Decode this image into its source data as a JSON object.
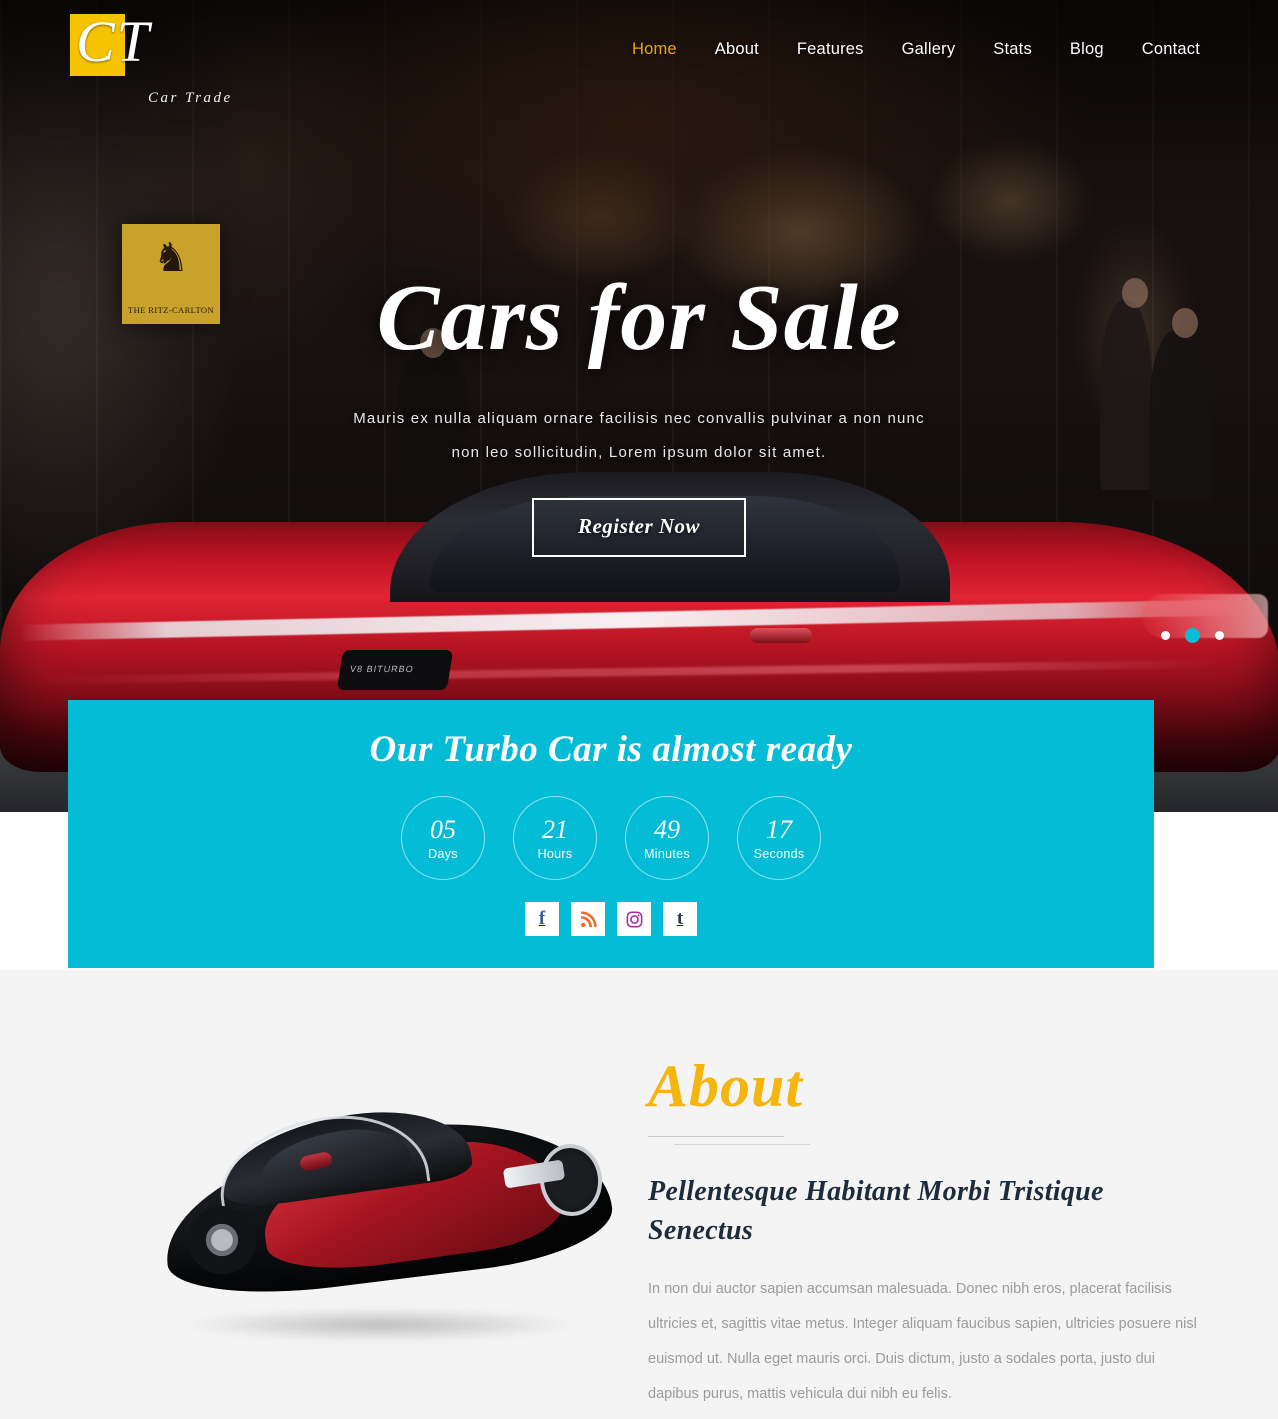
{
  "brand": {
    "logo_letters": "CT",
    "logo_tagline": "Car Trade",
    "accent_gold": "#f5c300",
    "accent_cyan": "#05bcd6",
    "accent_amber": "#f5b50f"
  },
  "nav": {
    "items": [
      {
        "label": "Home",
        "active": true
      },
      {
        "label": "About",
        "active": false
      },
      {
        "label": "Features",
        "active": false
      },
      {
        "label": "Gallery",
        "active": false
      },
      {
        "label": "Stats",
        "active": false
      },
      {
        "label": "Blog",
        "active": false
      },
      {
        "label": "Contact",
        "active": false
      }
    ]
  },
  "hero": {
    "title": "Cars for Sale",
    "subtitle": "Mauris ex nulla aliquam ornare facilisis nec convallis pulvinar a non nunc non leo sollicitudin, Lorem ipsum dolor sit amet.",
    "button_label": "Register Now",
    "backdrop_plaque": {
      "lion": "♞",
      "text": "THE RITZ-CARLTON"
    },
    "car_badge": "V8 BITURBO",
    "slider_dots": 3,
    "active_dot_index": 1
  },
  "countdown": {
    "title": "Our Turbo Car is almost ready",
    "units": [
      {
        "value": "05",
        "label": "Days"
      },
      {
        "value": "21",
        "label": "Hours"
      },
      {
        "value": "49",
        "label": "Minutes"
      },
      {
        "value": "17",
        "label": "Seconds"
      }
    ],
    "socials": [
      {
        "name": "facebook",
        "glyph": "f"
      },
      {
        "name": "rss",
        "glyph": "◜"
      },
      {
        "name": "instagram",
        "glyph": "▢"
      },
      {
        "name": "tumblr",
        "glyph": "t"
      }
    ]
  },
  "about": {
    "title": "About",
    "subtitle": "Pellentesque Habitant Morbi Tristique Senectus",
    "body": "In non dui auctor sapien accumsan malesuada. Donec nibh eros, placerat facilisis ultricies et, sagittis vitae metus. Integer aliquam faucibus sapien, ultricies posuere nisl euismod ut. Nulla eget mauris orci. Duis dictum, justo a sodales porta, justo dui dapibus purus, mattis vehicula dui nibh eu felis."
  }
}
